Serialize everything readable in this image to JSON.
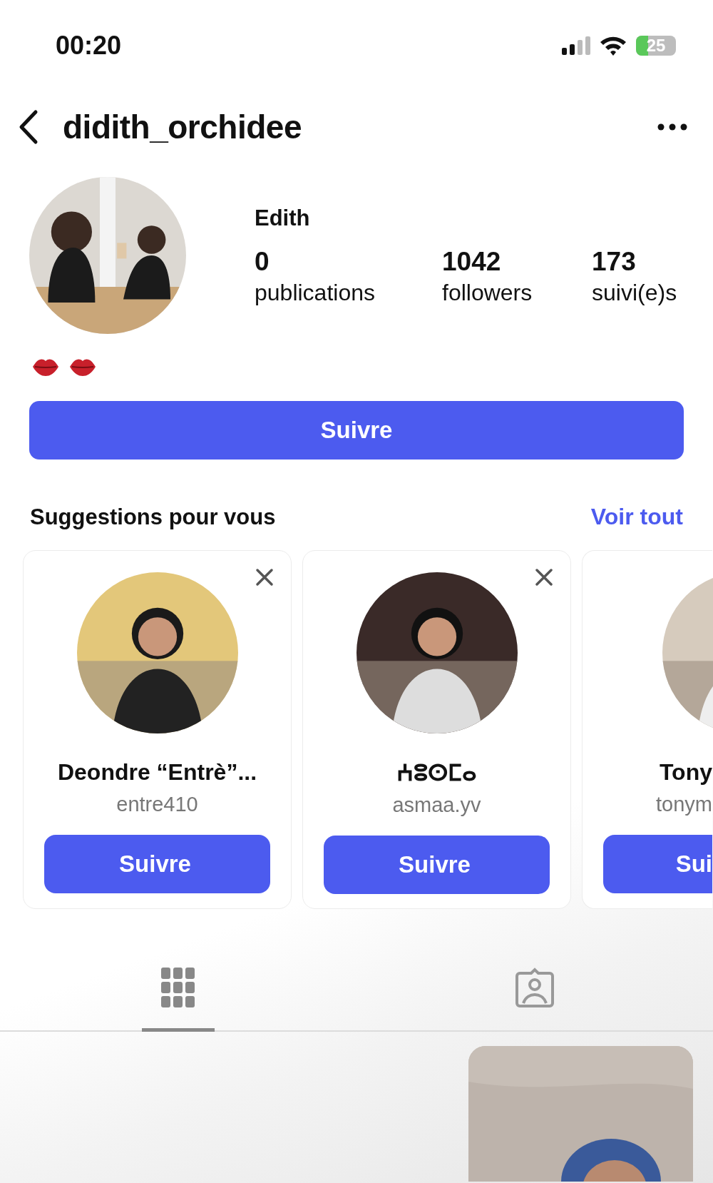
{
  "status_bar": {
    "time": "00:20",
    "battery": "25"
  },
  "header": {
    "username": "didith_orchidee"
  },
  "profile": {
    "name": "Edith",
    "stats": [
      {
        "value": "0",
        "label": "publications"
      },
      {
        "value": "1042",
        "label": "followers"
      },
      {
        "value": "173",
        "label": "suivi(e)s"
      }
    ],
    "bio": [
      {
        "kind": "lips"
      },
      {
        "kind": "lips"
      }
    ]
  },
  "follow_button": "Suivre",
  "suggestions": {
    "title": "Suggestions pour vous",
    "see_all": "Voir tout",
    "cards": [
      {
        "kind": "full",
        "name": "Deondre “Entrè”...",
        "username": "entre410",
        "button": "Suivre"
      },
      {
        "kind": "full",
        "name": "ⵄⵓⵙⵎⴰ",
        "username": "asmaa.yv",
        "button": "Suivre"
      },
      {
        "kind": "partial",
        "name": "Tony",
        "username": "tonym",
        "button": "Sui"
      }
    ]
  },
  "tabs": [
    {
      "kind": "grid",
      "selected": true
    },
    {
      "kind": "tagged",
      "selected": false
    }
  ]
}
